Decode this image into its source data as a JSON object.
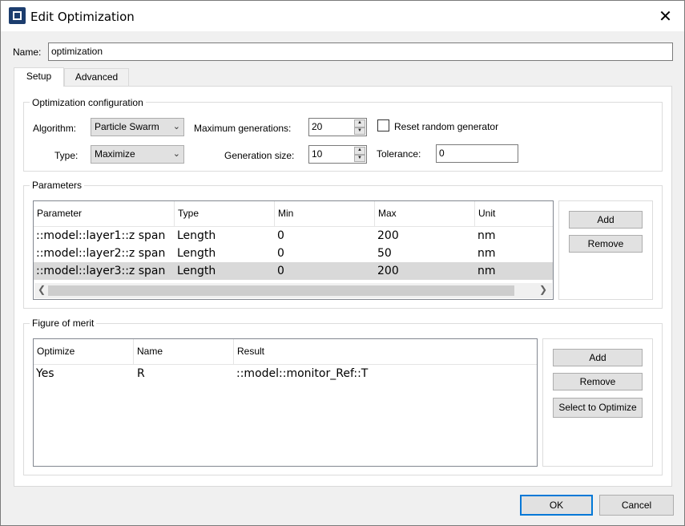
{
  "window": {
    "title": "Edit Optimization",
    "close_glyph": "✕"
  },
  "name_field": {
    "label": "Name:",
    "value": "optimization"
  },
  "tabs": [
    {
      "label": "Setup"
    },
    {
      "label": "Advanced"
    }
  ],
  "config": {
    "title": "Optimization configuration",
    "algorithm_label": "Algorithm:",
    "algorithm_value": "Particle Swarm",
    "type_label": "Type:",
    "type_value": "Maximize",
    "max_gen_label": "Maximum generations:",
    "max_gen_value": "20",
    "gen_size_label": "Generation size:",
    "gen_size_value": "10",
    "reset_label": "Reset random generator",
    "tolerance_label": "Tolerance:",
    "tolerance_value": "0"
  },
  "parameters": {
    "title": "Parameters",
    "columns": [
      "Parameter",
      "Type",
      "Min",
      "Max",
      "Unit"
    ],
    "rows": [
      {
        "parameter": "::model::layer1::z span",
        "type": "Length",
        "min": "0",
        "max": "200",
        "unit": "nm"
      },
      {
        "parameter": "::model::layer2::z span",
        "type": "Length",
        "min": "0",
        "max": "50",
        "unit": "nm"
      },
      {
        "parameter": "::model::layer3::z span",
        "type": "Length",
        "min": "0",
        "max": "200",
        "unit": "nm"
      }
    ],
    "add_label": "Add",
    "remove_label": "Remove"
  },
  "fom": {
    "title": "Figure of merit",
    "columns": [
      "Optimize",
      "Name",
      "Result"
    ],
    "rows": [
      {
        "optimize": "Yes",
        "name": "R",
        "result": "::model::monitor_Ref::T"
      }
    ],
    "add_label": "Add",
    "remove_label": "Remove",
    "select_label": "Select to Optimize"
  },
  "footer": {
    "ok_label": "OK",
    "cancel_label": "Cancel"
  }
}
